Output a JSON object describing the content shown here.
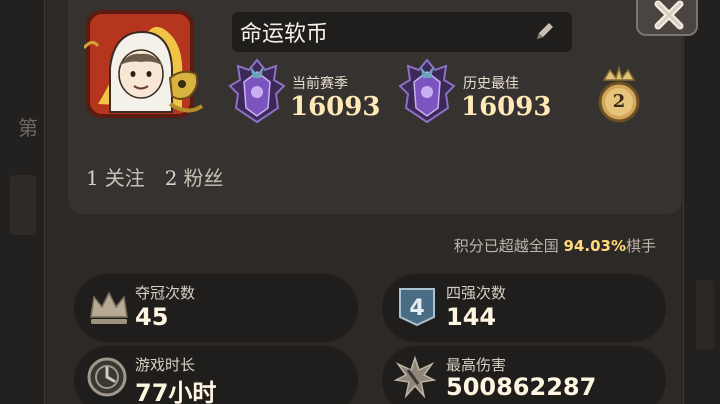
{
  "profile": {
    "name": "命运软币",
    "following_count": "1",
    "following_label": "关注",
    "followers_count": "2",
    "followers_label": "粉丝",
    "badge_level": "2"
  },
  "ranks": {
    "current_label": "当前赛季",
    "current_value": "16093",
    "best_label": "历史最佳",
    "best_value": "16093"
  },
  "percentile": {
    "prefix": "积分已超越全国",
    "value": "94.03%",
    "suffix": "棋手"
  },
  "stats": [
    {
      "label": "夺冠次数",
      "value": "45",
      "icon": "crown-icon"
    },
    {
      "label": "四强次数",
      "value": "144",
      "icon": "top-four-icon"
    },
    {
      "label": "游戏时长",
      "value": "77小时",
      "icon": "clock-icon"
    },
    {
      "label": "最高伤害",
      "value": "500862287",
      "icon": "damage-burst-icon"
    }
  ],
  "colors": {
    "panel": "#2c2926",
    "card": "#353230",
    "stat_card": "#201e1c",
    "gold": "#ffd97a",
    "rank_purple": "#6d4aa8"
  }
}
